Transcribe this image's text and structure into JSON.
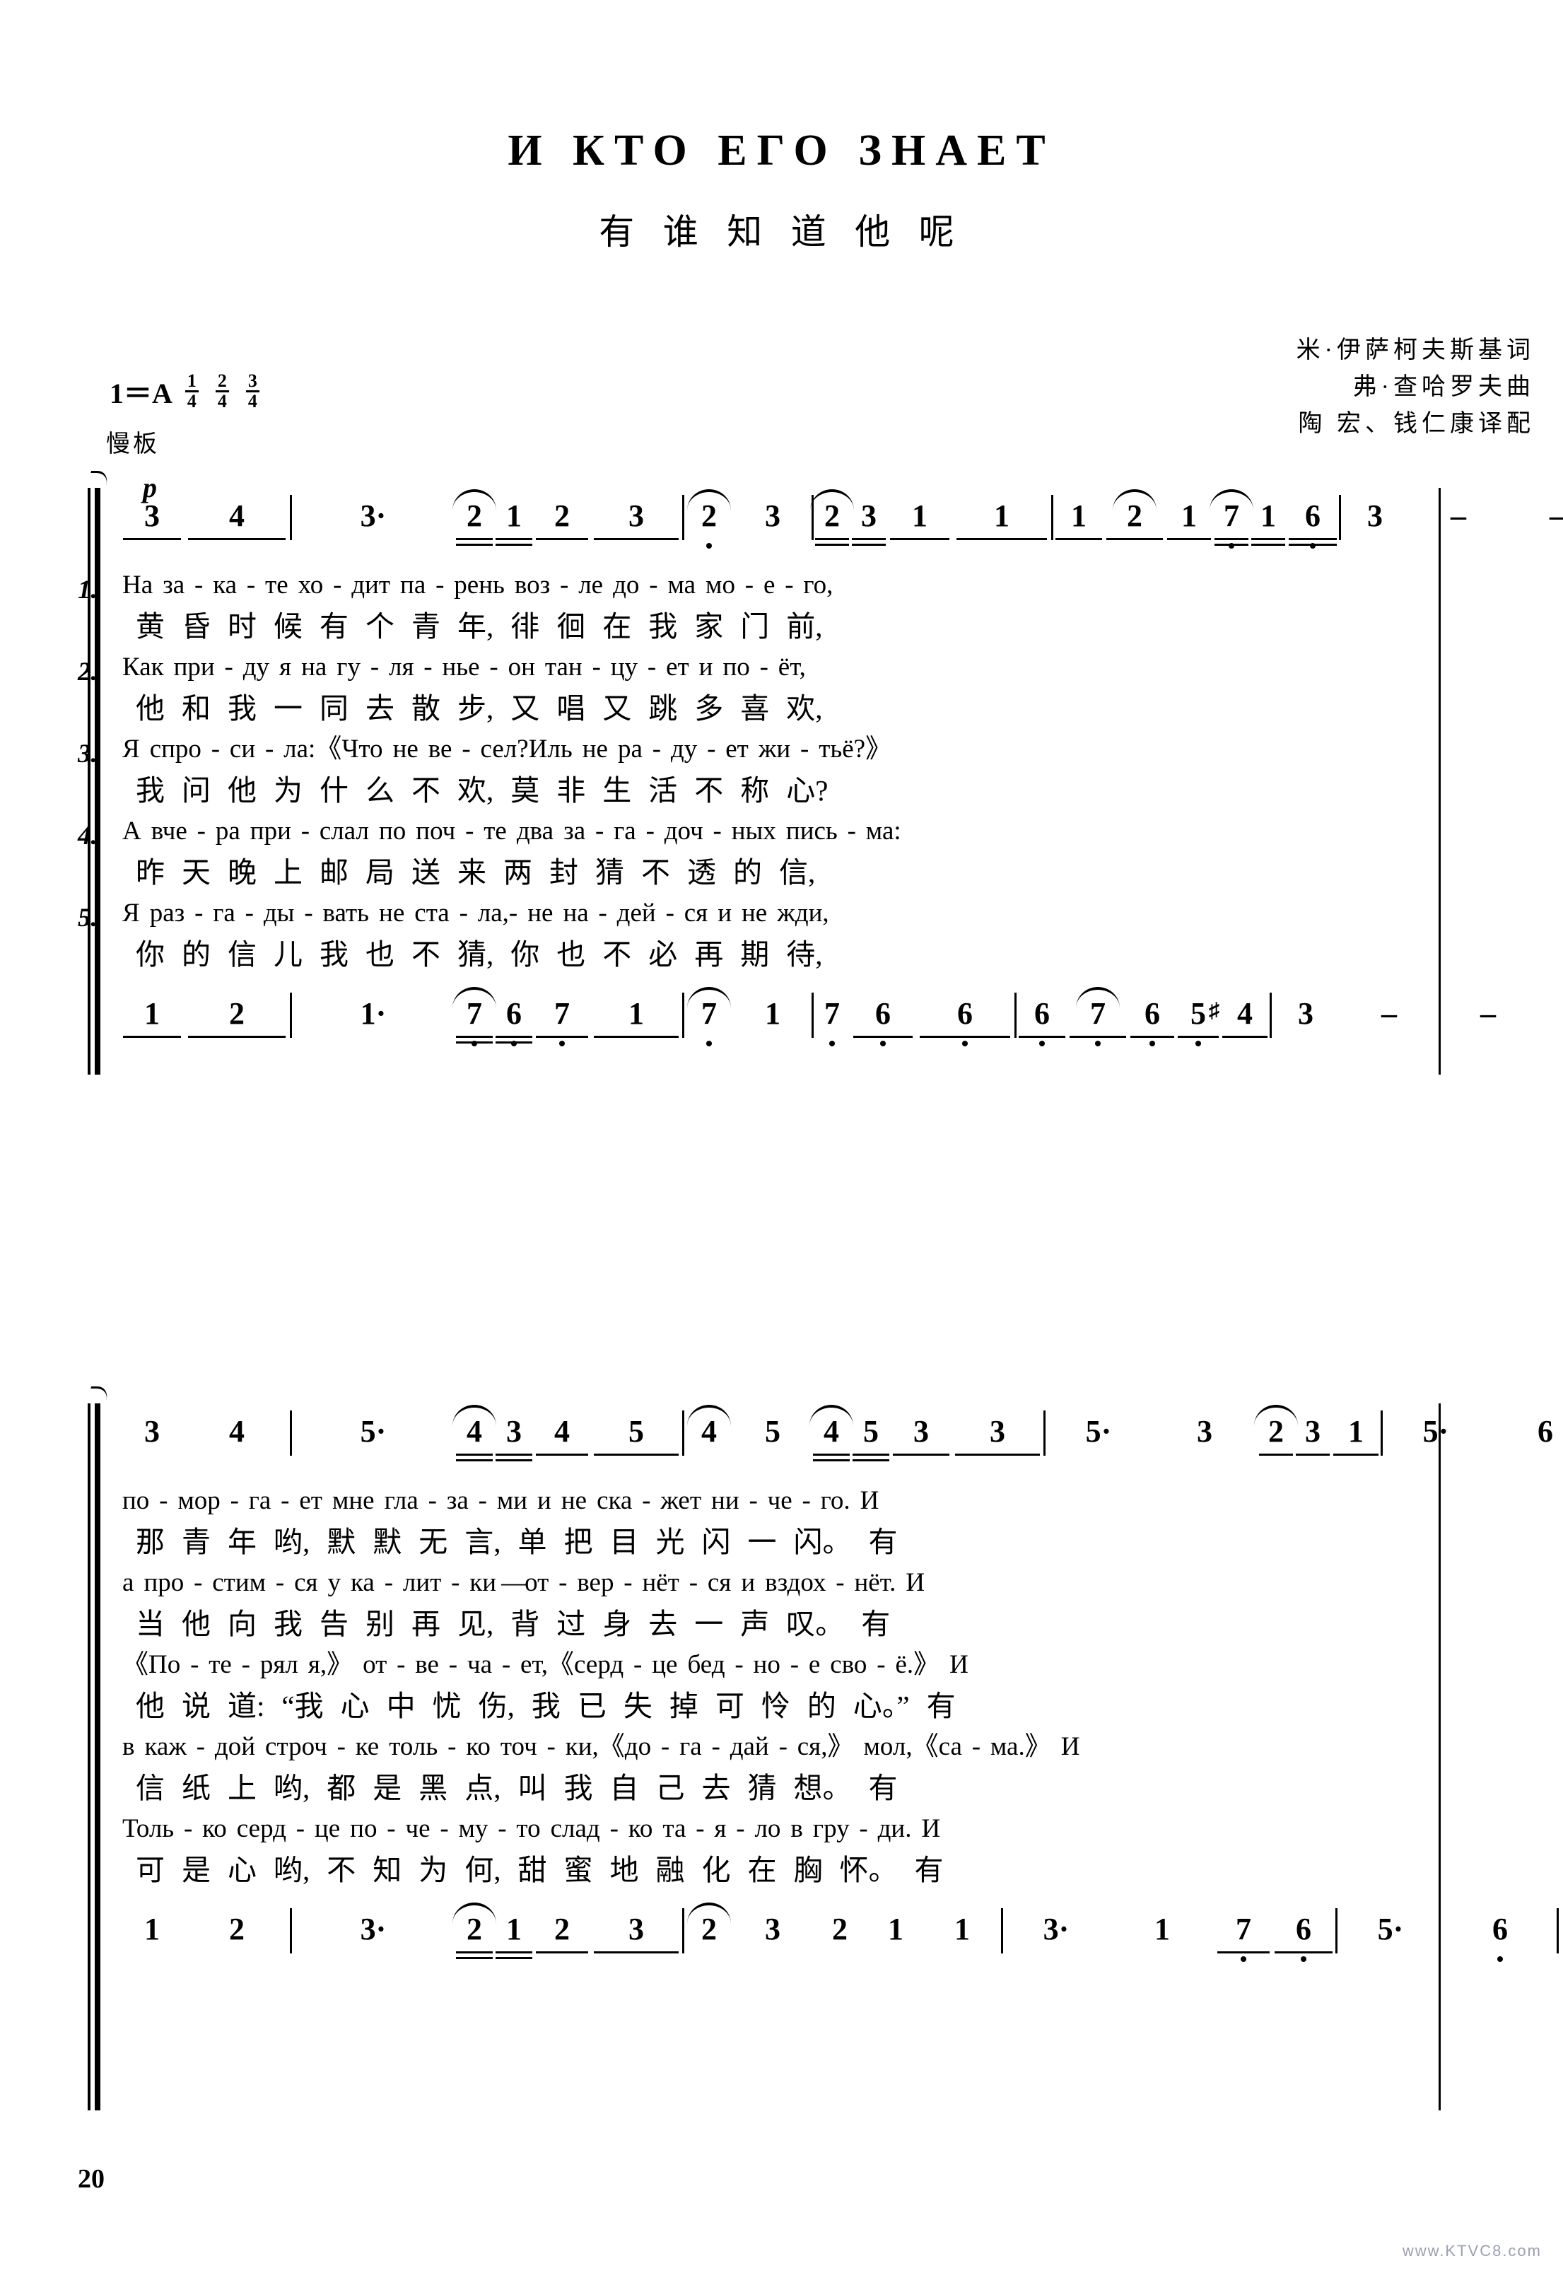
{
  "header": {
    "title_ru": "И  КТО  ЕГО  ЗНАЕТ",
    "title_cn": "有 谁 知 道 他 呢",
    "key": "1＝A",
    "meters": [
      {
        "num": "1",
        "den": "4"
      },
      {
        "num": "2",
        "den": "4"
      },
      {
        "num": "3",
        "den": "4"
      }
    ],
    "tempo": "慢板",
    "credits": [
      "米·伊萨柯夫斯基词",
      "弗·查哈罗夫曲",
      "陶 宏、钱仁康译配"
    ]
  },
  "dynamics": {
    "soft": "p"
  },
  "system1": {
    "melody": [
      {
        "t": "3",
        "beam": 1
      },
      {
        "t": "4",
        "beam": 1
      },
      {
        "t": "|"
      },
      {
        "t": "3",
        "dot": true
      },
      {
        "t": "2",
        "beam": 2,
        "slur": true
      },
      {
        "t": "1",
        "beam": 2
      },
      {
        "t": "2",
        "beam": 1
      },
      {
        "t": "3",
        "beam": 1
      },
      {
        "t": "|"
      },
      {
        "t": "2",
        "slur": true,
        "low": 1
      },
      {
        "t": "3"
      },
      {
        "t": "|"
      },
      {
        "t": "2",
        "beam": 2,
        "slur": true
      },
      {
        "t": "3",
        "beam": 2
      },
      {
        "t": "1",
        "beam": 1
      },
      {
        "t": "1",
        "beam": 1
      },
      {
        "t": "|"
      },
      {
        "t": "1",
        "beam": 1
      },
      {
        "t": "2",
        "beam": 1,
        "slur": true
      },
      {
        "t": "1",
        "beam": 1
      },
      {
        "t": "7",
        "beam": 2,
        "slur": true,
        "low": 1
      },
      {
        "t": "1",
        "beam": 2
      },
      {
        "t": "6",
        "beam": 2,
        "low": 1
      },
      {
        "t": "|"
      },
      {
        "t": "3"
      },
      {
        "t": "–"
      },
      {
        "t": "–"
      }
    ],
    "bass": [
      {
        "t": "1",
        "beam": 1
      },
      {
        "t": "2",
        "beam": 1
      },
      {
        "t": "|"
      },
      {
        "t": "1",
        "dot": true
      },
      {
        "t": "7",
        "beam": 2,
        "slur": true,
        "low": 1
      },
      {
        "t": "6",
        "beam": 2,
        "low": 1
      },
      {
        "t": "7",
        "beam": 1,
        "low": 1
      },
      {
        "t": "1",
        "beam": 1
      },
      {
        "t": "|"
      },
      {
        "t": "7",
        "slur": true,
        "low": 1
      },
      {
        "t": "1"
      },
      {
        "t": "|"
      },
      {
        "t": "7",
        "low": 1
      },
      {
        "t": "6",
        "beam": 1,
        "low": 1
      },
      {
        "t": "6",
        "beam": 1,
        "low": 1
      },
      {
        "t": "|"
      },
      {
        "t": "6",
        "beam": 1,
        "low": 1
      },
      {
        "t": "7",
        "beam": 1,
        "slur": true,
        "low": 1
      },
      {
        "t": "6",
        "beam": 1,
        "low": 1
      },
      {
        "t": "5",
        "beam": 1,
        "low": 1
      },
      {
        "t": "4",
        "beam": 1,
        "sharp": true
      },
      {
        "t": "|"
      },
      {
        "t": "3"
      },
      {
        "t": "–"
      },
      {
        "t": "–"
      }
    ],
    "verses": [
      {
        "num": "1.",
        "ru": [
          "На",
          "за",
          "-",
          "ка",
          "-",
          "те",
          "хо",
          "-",
          "дит",
          "па",
          "-",
          "рень",
          "воз",
          "-",
          "ле",
          "до",
          "-",
          "ма",
          "мо",
          "-",
          "е",
          "-",
          "го,"
        ],
        "cn": [
          "黄",
          "昏",
          "时",
          "候",
          "有",
          "个",
          "青",
          "年,",
          "徘",
          "徊",
          "在",
          "我",
          "家",
          "门",
          "前,"
        ]
      },
      {
        "num": "2.",
        "ru": [
          "Как",
          "при",
          "-",
          "ду",
          "я",
          "на",
          "гу",
          "-",
          "ля",
          "-",
          "нье",
          "-",
          "он",
          "тан",
          "-",
          "цу",
          "-",
          "ет",
          "и",
          "по",
          "-",
          "ёт,"
        ],
        "cn": [
          "他",
          "和",
          "我",
          "一",
          "同",
          "去",
          "散",
          "步,",
          "又",
          "唱",
          "又",
          "跳",
          "多",
          "喜",
          "欢,"
        ]
      },
      {
        "num": "3.",
        "ru": [
          "Я",
          "спро",
          "-",
          "си",
          "-",
          "ла:《Что",
          "не",
          "ве",
          "-",
          "сел?Иль",
          "не",
          "ра",
          "-",
          "ду",
          "-",
          "ет",
          "жи",
          "-",
          "тьё?》"
        ],
        "cn": [
          "我",
          "问",
          "他",
          "为",
          "什",
          "么",
          "不",
          "欢,",
          "莫",
          "非",
          "生",
          "活",
          "不",
          "称",
          "心?"
        ]
      },
      {
        "num": "4.",
        "ru": [
          "А",
          "вче",
          "-",
          "ра",
          "при",
          "-",
          "слал",
          "по",
          "поч",
          "-",
          "те",
          "два",
          "за",
          "-",
          "га",
          "-",
          "доч",
          "-",
          "ных",
          "пись",
          "-",
          "ма:"
        ],
        "cn": [
          "昨",
          "天",
          "晚",
          "上",
          "邮",
          "局",
          "送",
          "来",
          "两",
          "封",
          "猜",
          "不",
          "透",
          "的",
          "信,"
        ]
      },
      {
        "num": "5.",
        "ru": [
          "Я",
          "раз",
          "-",
          "га",
          "-",
          "ды",
          "-",
          "вать",
          "не",
          "ста",
          "-",
          "ла,-",
          "не",
          "на",
          "-",
          "дей",
          "-",
          "ся",
          "и",
          "не",
          "жди,"
        ],
        "cn": [
          "你",
          "的",
          "信",
          "儿",
          "我",
          "也",
          "不",
          "猜,",
          "你",
          "也",
          "不",
          "必",
          "再",
          "期",
          "待,"
        ]
      }
    ]
  },
  "system2": {
    "melody": [
      {
        "t": "3"
      },
      {
        "t": "4"
      },
      {
        "t": "|"
      },
      {
        "t": "5",
        "dot": true
      },
      {
        "t": "4",
        "beam": 2,
        "slur": true
      },
      {
        "t": "3",
        "beam": 2
      },
      {
        "t": "4",
        "beam": 1
      },
      {
        "t": "5",
        "beam": 1
      },
      {
        "t": "|"
      },
      {
        "t": "4",
        "slur": true
      },
      {
        "t": "5"
      },
      {
        "t": "4",
        "beam": 2,
        "slur": true
      },
      {
        "t": "5",
        "beam": 2
      },
      {
        "t": "3",
        "beam": 1
      },
      {
        "t": "3",
        "beam": 1
      },
      {
        "t": "|"
      },
      {
        "t": "5",
        "dot": true
      },
      {
        "t": "3"
      },
      {
        "t": "2",
        "beam": 1,
        "slur": true
      },
      {
        "t": "3",
        "beam": 1
      },
      {
        "t": "1",
        "beam": 1
      },
      {
        "t": "|"
      },
      {
        "t": "5",
        "dot": true
      },
      {
        "t": "6"
      },
      {
        "t": "|"
      }
    ],
    "bass": [
      {
        "t": "1"
      },
      {
        "t": "2"
      },
      {
        "t": "|"
      },
      {
        "t": "3",
        "dot": true
      },
      {
        "t": "2",
        "beam": 2,
        "slur": true
      },
      {
        "t": "1",
        "beam": 2
      },
      {
        "t": "2",
        "beam": 1
      },
      {
        "t": "3",
        "beam": 1
      },
      {
        "t": "|"
      },
      {
        "t": "2",
        "slur": true
      },
      {
        "t": "3"
      },
      {
        "t": "2"
      },
      {
        "t": "1"
      },
      {
        "t": "1"
      },
      {
        "t": "|"
      },
      {
        "t": "3",
        "dot": true
      },
      {
        "t": "1"
      },
      {
        "t": "7",
        "beam": 1,
        "low": 1
      },
      {
        "t": "6",
        "beam": 1,
        "low": 1
      },
      {
        "t": "|"
      },
      {
        "t": "5",
        "dot": true
      },
      {
        "t": "6",
        "low": 1
      },
      {
        "t": "|"
      }
    ],
    "verses": [
      {
        "num": "",
        "ru": [
          "по",
          "-",
          "мор",
          "-",
          "га",
          "-",
          "ет",
          "мне",
          "гла",
          "-",
          "за",
          "-",
          "ми",
          "и",
          "не",
          "ска",
          "-",
          "жет",
          "ни",
          "-",
          "че",
          "-",
          "го.",
          "И"
        ],
        "cn": [
          "那",
          "青",
          "年",
          "哟,",
          "默",
          "默",
          "无",
          "言,",
          "单",
          "把",
          "目",
          "光",
          "闪",
          "一",
          "闪。",
          "有"
        ]
      },
      {
        "num": "",
        "ru": [
          "а",
          "про",
          "-",
          "стим",
          "-",
          "ся",
          "у",
          "ка",
          "-",
          "лит",
          "-",
          "ки",
          "—",
          "от",
          "-",
          "вер",
          "-",
          "нёт",
          "-",
          "ся",
          "и",
          "вздох",
          "-",
          "нёт.",
          "И"
        ],
        "cn": [
          "当",
          "他",
          "向",
          "我",
          "告",
          "别",
          "再",
          "见,",
          "背",
          "过",
          "身",
          "去",
          "一",
          "声",
          "叹。",
          "有"
        ]
      },
      {
        "num": "",
        "ru": [
          "《По",
          "-",
          "те",
          "-",
          "рял",
          "я,》",
          "от",
          "-",
          "ве",
          "-",
          "ча",
          "-",
          "ет,《серд",
          "-",
          "це",
          "бед",
          "-",
          "но",
          "-",
          "е",
          "сво",
          "-",
          "ё.》",
          "И"
        ],
        "cn": [
          "他",
          "说",
          "道:",
          "“我",
          "心",
          "中",
          "忧",
          "伤,",
          "我",
          "已",
          "失",
          "掉",
          "可",
          "怜",
          "的",
          "心。”",
          "有"
        ]
      },
      {
        "num": "",
        "ru": [
          "в",
          "каж",
          "-",
          "дой",
          "строч",
          "-",
          "ке",
          "толь",
          "-",
          "ко",
          "точ",
          "-",
          "ки,《до",
          "-",
          "га",
          "-",
          "дай",
          "-",
          "ся,》",
          "мол,《са",
          "-",
          "ма.》",
          "И"
        ],
        "cn": [
          "信",
          "纸",
          "上",
          "哟,",
          "都",
          "是",
          "黑",
          "点,",
          "叫",
          "我",
          "自",
          "己",
          "去",
          "猜",
          "想。",
          "有"
        ]
      },
      {
        "num": "",
        "ru": [
          "Толь",
          "-",
          "ко",
          "серд",
          "-",
          "це",
          "по",
          "-",
          "че",
          "-",
          "му",
          "-",
          "то",
          "слад",
          "-",
          "ко",
          "та",
          "-",
          "я",
          "-",
          "ло",
          "в",
          "гру",
          "-",
          "ди.",
          "И"
        ],
        "cn": [
          "可",
          "是",
          "心",
          "哟,",
          "不",
          "知",
          "为",
          "何,",
          "甜",
          "蜜",
          "地",
          "融",
          "化",
          "在",
          "胸",
          "怀。",
          "有"
        ]
      }
    ]
  },
  "page_number": "20",
  "watermark": "www.KTVC8.com"
}
